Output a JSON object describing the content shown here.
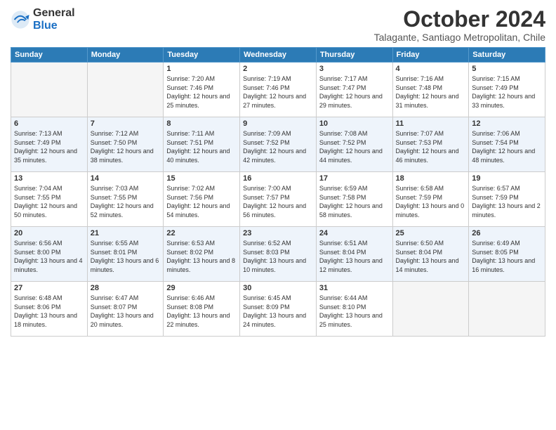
{
  "header": {
    "logo": {
      "general": "General",
      "blue": "Blue"
    },
    "month": "October 2024",
    "location": "Talagante, Santiago Metropolitan, Chile"
  },
  "days_of_week": [
    "Sunday",
    "Monday",
    "Tuesday",
    "Wednesday",
    "Thursday",
    "Friday",
    "Saturday"
  ],
  "weeks": [
    [
      {
        "day": "",
        "info": ""
      },
      {
        "day": "",
        "info": ""
      },
      {
        "day": "1",
        "sunrise": "7:20 AM",
        "sunset": "7:46 PM",
        "daylight": "12 hours and 25 minutes."
      },
      {
        "day": "2",
        "sunrise": "7:19 AM",
        "sunset": "7:46 PM",
        "daylight": "12 hours and 27 minutes."
      },
      {
        "day": "3",
        "sunrise": "7:17 AM",
        "sunset": "7:47 PM",
        "daylight": "12 hours and 29 minutes."
      },
      {
        "day": "4",
        "sunrise": "7:16 AM",
        "sunset": "7:48 PM",
        "daylight": "12 hours and 31 minutes."
      },
      {
        "day": "5",
        "sunrise": "7:15 AM",
        "sunset": "7:49 PM",
        "daylight": "12 hours and 33 minutes."
      }
    ],
    [
      {
        "day": "6",
        "sunrise": "7:13 AM",
        "sunset": "7:49 PM",
        "daylight": "12 hours and 35 minutes."
      },
      {
        "day": "7",
        "sunrise": "7:12 AM",
        "sunset": "7:50 PM",
        "daylight": "12 hours and 38 minutes."
      },
      {
        "day": "8",
        "sunrise": "7:11 AM",
        "sunset": "7:51 PM",
        "daylight": "12 hours and 40 minutes."
      },
      {
        "day": "9",
        "sunrise": "7:09 AM",
        "sunset": "7:52 PM",
        "daylight": "12 hours and 42 minutes."
      },
      {
        "day": "10",
        "sunrise": "7:08 AM",
        "sunset": "7:52 PM",
        "daylight": "12 hours and 44 minutes."
      },
      {
        "day": "11",
        "sunrise": "7:07 AM",
        "sunset": "7:53 PM",
        "daylight": "12 hours and 46 minutes."
      },
      {
        "day": "12",
        "sunrise": "7:06 AM",
        "sunset": "7:54 PM",
        "daylight": "12 hours and 48 minutes."
      }
    ],
    [
      {
        "day": "13",
        "sunrise": "7:04 AM",
        "sunset": "7:55 PM",
        "daylight": "12 hours and 50 minutes."
      },
      {
        "day": "14",
        "sunrise": "7:03 AM",
        "sunset": "7:55 PM",
        "daylight": "12 hours and 52 minutes."
      },
      {
        "day": "15",
        "sunrise": "7:02 AM",
        "sunset": "7:56 PM",
        "daylight": "12 hours and 54 minutes."
      },
      {
        "day": "16",
        "sunrise": "7:00 AM",
        "sunset": "7:57 PM",
        "daylight": "12 hours and 56 minutes."
      },
      {
        "day": "17",
        "sunrise": "6:59 AM",
        "sunset": "7:58 PM",
        "daylight": "12 hours and 58 minutes."
      },
      {
        "day": "18",
        "sunrise": "6:58 AM",
        "sunset": "7:59 PM",
        "daylight": "13 hours and 0 minutes."
      },
      {
        "day": "19",
        "sunrise": "6:57 AM",
        "sunset": "7:59 PM",
        "daylight": "13 hours and 2 minutes."
      }
    ],
    [
      {
        "day": "20",
        "sunrise": "6:56 AM",
        "sunset": "8:00 PM",
        "daylight": "13 hours and 4 minutes."
      },
      {
        "day": "21",
        "sunrise": "6:55 AM",
        "sunset": "8:01 PM",
        "daylight": "13 hours and 6 minutes."
      },
      {
        "day": "22",
        "sunrise": "6:53 AM",
        "sunset": "8:02 PM",
        "daylight": "13 hours and 8 minutes."
      },
      {
        "day": "23",
        "sunrise": "6:52 AM",
        "sunset": "8:03 PM",
        "daylight": "13 hours and 10 minutes."
      },
      {
        "day": "24",
        "sunrise": "6:51 AM",
        "sunset": "8:04 PM",
        "daylight": "13 hours and 12 minutes."
      },
      {
        "day": "25",
        "sunrise": "6:50 AM",
        "sunset": "8:04 PM",
        "daylight": "13 hours and 14 minutes."
      },
      {
        "day": "26",
        "sunrise": "6:49 AM",
        "sunset": "8:05 PM",
        "daylight": "13 hours and 16 minutes."
      }
    ],
    [
      {
        "day": "27",
        "sunrise": "6:48 AM",
        "sunset": "8:06 PM",
        "daylight": "13 hours and 18 minutes."
      },
      {
        "day": "28",
        "sunrise": "6:47 AM",
        "sunset": "8:07 PM",
        "daylight": "13 hours and 20 minutes."
      },
      {
        "day": "29",
        "sunrise": "6:46 AM",
        "sunset": "8:08 PM",
        "daylight": "13 hours and 22 minutes."
      },
      {
        "day": "30",
        "sunrise": "6:45 AM",
        "sunset": "8:09 PM",
        "daylight": "13 hours and 24 minutes."
      },
      {
        "day": "31",
        "sunrise": "6:44 AM",
        "sunset": "8:10 PM",
        "daylight": "13 hours and 25 minutes."
      },
      {
        "day": "",
        "info": ""
      },
      {
        "day": "",
        "info": ""
      }
    ]
  ]
}
